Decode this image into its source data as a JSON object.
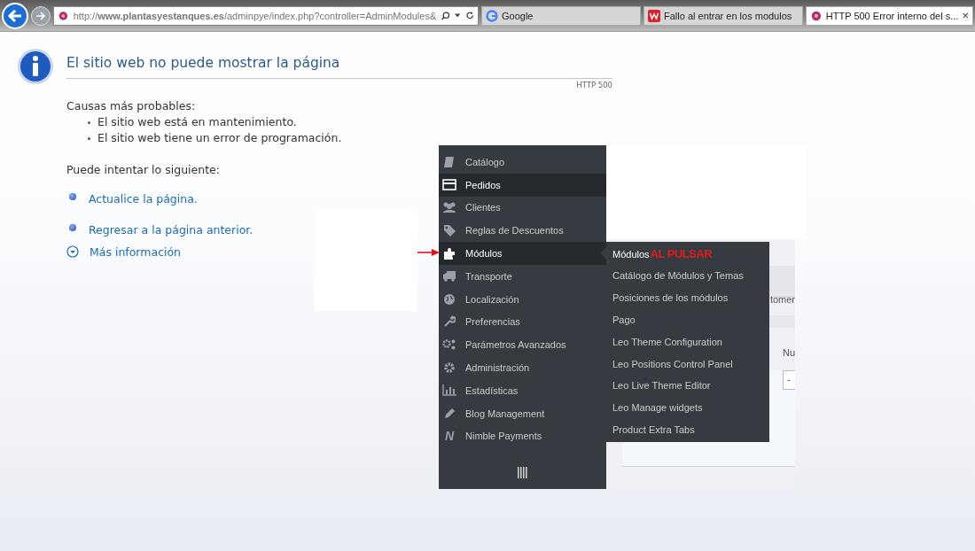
{
  "browser": {
    "url": "http://**www.plantasyestanques.es**/adminpye/index.php?controller=AdminModules&",
    "tabs": [
      {
        "kind": "google",
        "label": "Google",
        "selected": false,
        "closable": false
      },
      {
        "kind": "forum",
        "label": "Fallo al entrar en los modulos",
        "selected": false,
        "closable": false
      },
      {
        "kind": "site",
        "label": "HTTP 500 Error interno del s...",
        "selected": true,
        "closable": true
      }
    ],
    "close_glyph": "×"
  },
  "error_page": {
    "title": "El sitio web no puede mostrar la página",
    "code": "HTTP 500",
    "causes_heading": "Causas más probables:",
    "causes": [
      "El sitio web está en mantenimiento.",
      "El sitio web tiene un error de programación."
    ],
    "try_heading": "Puede intentar lo siguiente:",
    "actions": [
      {
        "kind": "bullet",
        "label": "Actualice la página."
      },
      {
        "kind": "bullet",
        "label": "Regresar a la página anterior."
      },
      {
        "kind": "expand",
        "label": "Más información"
      }
    ]
  },
  "admin_menu": {
    "items": [
      {
        "kind": "book",
        "label": "Catálogo",
        "highlighted": false,
        "expanded": false
      },
      {
        "kind": "card",
        "label": "Pedidos",
        "highlighted": true,
        "expanded": false
      },
      {
        "kind": "users",
        "label": "Clientes",
        "highlighted": false,
        "expanded": false
      },
      {
        "kind": "tag",
        "label": "Reglas de Descuentos",
        "highlighted": false,
        "expanded": false
      },
      {
        "kind": "puzzle",
        "label": "Módulos",
        "highlighted": true,
        "expanded": true
      },
      {
        "kind": "truck",
        "label": "Transporte",
        "highlighted": false,
        "expanded": false
      },
      {
        "kind": "globe",
        "label": "Localización",
        "highlighted": false,
        "expanded": false
      },
      {
        "kind": "wrench",
        "label": "Preferencias",
        "highlighted": false,
        "expanded": false
      },
      {
        "kind": "gears",
        "label": "Parámetros Avanzados",
        "highlighted": false,
        "expanded": false
      },
      {
        "kind": "gear",
        "label": "Administración",
        "highlighted": false,
        "expanded": false
      },
      {
        "kind": "chart",
        "label": "Estadísticas",
        "highlighted": false,
        "expanded": false
      },
      {
        "kind": "pencil",
        "label": "Blog Management",
        "highlighted": false,
        "expanded": false
      },
      {
        "kind": "letter",
        "glyph": "N",
        "label": "Nimble Payments",
        "highlighted": false,
        "expanded": false
      }
    ],
    "submenu": [
      "Módulos",
      "Catálogo de Módulos y Temas",
      "Posiciones de los módulos",
      "Pago",
      "Leo Theme Configuration",
      "Leo Positions Control Panel",
      "Leo Live Theme Editor",
      "Leo Manage widgets",
      "Product Extra Tabs"
    ],
    "annotation": "AL PULSAR"
  },
  "background_page": {
    "column_text": "tomer",
    "column_header": "Nu",
    "field_value": "-"
  }
}
